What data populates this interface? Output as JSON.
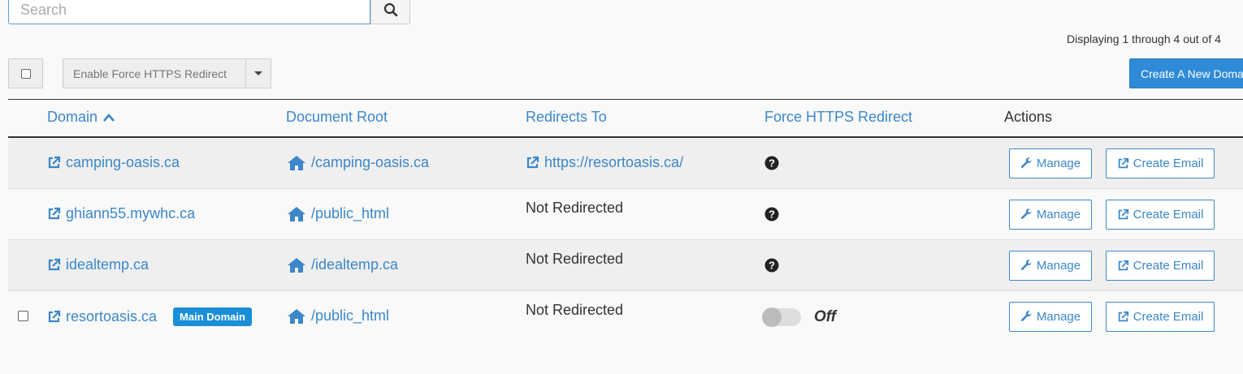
{
  "search": {
    "placeholder": "Search"
  },
  "pagination": {
    "display_text": "Displaying 1 through 4 out of 4"
  },
  "toolbar": {
    "bulk_action_label": "Enable Force HTTPS Redirect",
    "create_label": "Create A New Domain"
  },
  "table": {
    "headers": {
      "domain": "Domain",
      "document_root": "Document Root",
      "redirects_to": "Redirects To",
      "force_https": "Force HTTPS Redirect",
      "actions": "Actions"
    },
    "rows": [
      {
        "domain": "camping-oasis.ca",
        "document_root": "/camping-oasis.ca",
        "redirects_to": "https://resortoasis.ca/",
        "manage": "Manage",
        "create_email": "Create Email"
      },
      {
        "domain": "ghiann55.mywhc.ca",
        "document_root": "/public_html",
        "redirects_to": "Not Redirected",
        "manage": "Manage",
        "create_email": "Create Email"
      },
      {
        "domain": "idealtemp.ca",
        "document_root": "/idealtemp.ca",
        "redirects_to": "Not Redirected",
        "manage": "Manage",
        "create_email": "Create Email"
      },
      {
        "domain": "resortoasis.ca",
        "badge": "Main Domain",
        "document_root": "/public_html",
        "redirects_to": "Not Redirected",
        "force_https_state": "Off",
        "manage": "Manage",
        "create_email": "Create Email"
      }
    ]
  },
  "icons": {
    "search": "search-icon",
    "external_link": "external-link-icon",
    "home": "home-icon",
    "help": "question-circle-icon",
    "wrench": "wrench-icon",
    "sort": "chevron-up-icon"
  },
  "colors": {
    "link": "#3b87c9",
    "primary_button": "#2f8bd8",
    "badge": "#1a8fd8"
  }
}
